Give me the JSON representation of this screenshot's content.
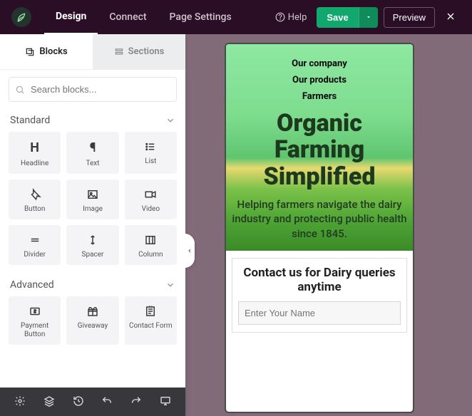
{
  "topbar": {
    "tabs": {
      "design": "Design",
      "connect": "Connect",
      "page_settings": "Page Settings"
    },
    "help": "Help",
    "save": "Save",
    "preview": "Preview"
  },
  "sidebar": {
    "tabs": {
      "blocks": "Blocks",
      "sections": "Sections"
    },
    "search_placeholder": "Search blocks...",
    "standard_label": "Standard",
    "standard": [
      {
        "key": "headline",
        "label": "Headline"
      },
      {
        "key": "text",
        "label": "Text"
      },
      {
        "key": "list",
        "label": "List"
      },
      {
        "key": "button",
        "label": "Button"
      },
      {
        "key": "image",
        "label": "Image"
      },
      {
        "key": "video",
        "label": "Video"
      },
      {
        "key": "divider",
        "label": "Divider"
      },
      {
        "key": "spacer",
        "label": "Spacer"
      },
      {
        "key": "column",
        "label": "Column"
      }
    ],
    "advanced_label": "Advanced",
    "advanced": [
      {
        "key": "payment-button",
        "label": "Payment Button"
      },
      {
        "key": "giveaway",
        "label": "Giveaway"
      },
      {
        "key": "contact-form",
        "label": "Contact Form"
      }
    ]
  },
  "preview": {
    "nav": [
      "Our company",
      "Our products",
      "Farmers"
    ],
    "headline": "Organic Farming Simplified",
    "subhead": "Helping farmers navigate the dairy industry and protecting public health since 1845.",
    "contact_title": "Contact us for Dairy queries anytime",
    "name_placeholder": "Enter Your Name"
  }
}
